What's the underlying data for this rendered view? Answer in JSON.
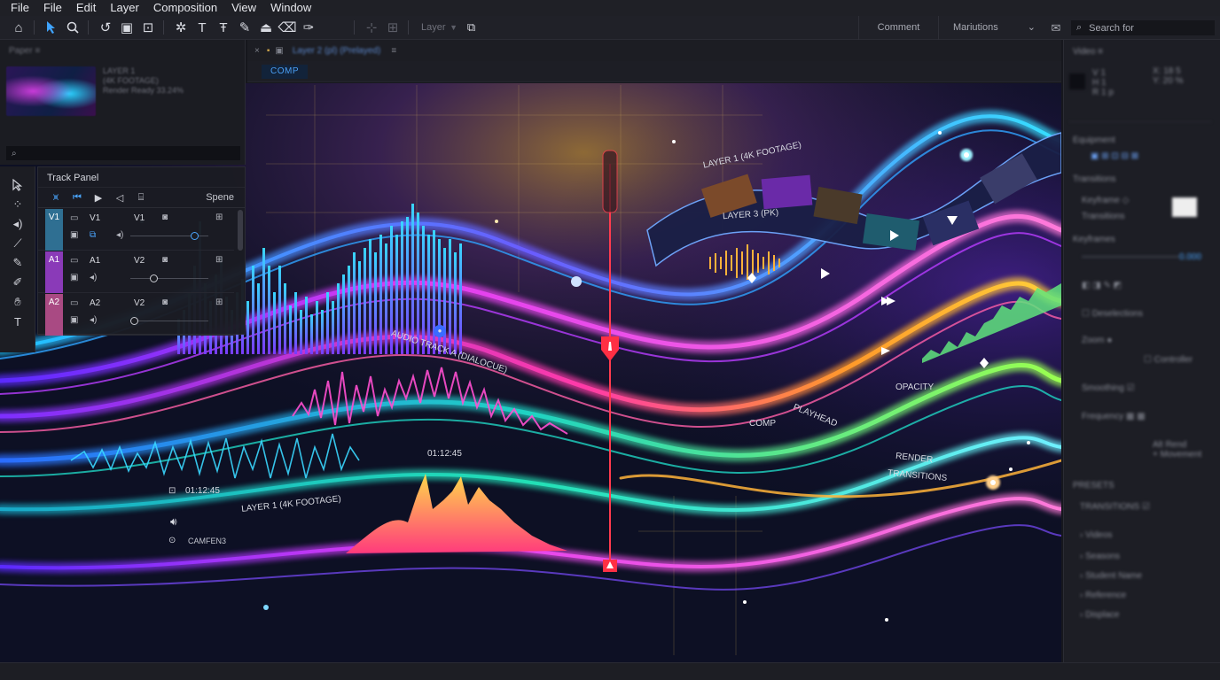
{
  "menu": [
    "File",
    "File",
    "Edit",
    "Layer",
    "Composition",
    "View",
    "Window"
  ],
  "toolbar": {
    "layer_label": "Layer",
    "comment_label": "Comment",
    "markers_label": "Mariutions",
    "search_placeholder": "Search for"
  },
  "comp": {
    "tab_label": "Layer 2 (pl) (Prelayed)",
    "comp_tag": "COMP"
  },
  "track_panel": {
    "title": "Track Panel",
    "mode_label": "Spene",
    "tracks": [
      {
        "id": "V1",
        "name": "V1",
        "out": "V1",
        "color": "#2f6f92"
      },
      {
        "id": "A1",
        "name": "A1",
        "out": "V2",
        "color": "#8a3ab8"
      },
      {
        "id": "A2",
        "name": "A2",
        "out": "V2",
        "color": "#a94a83"
      }
    ]
  },
  "overlay": {
    "timecode_left": "01:12:45",
    "timecode_center": "01:12:45",
    "camera_label": "CAMFEN3",
    "layer1_bottom": "LAYER 1 (4K FOOTAGE)",
    "layer1_top": "LAYER 1 (4K FOOTAGE)",
    "layer3": "LAYER 3 (PK)",
    "audio_track": "AUDIO TRACK A (DIALOCUE)",
    "opacity": "OPACITY",
    "playhead": "PLAYHEAD",
    "comp": "COMP",
    "render": "RENDER",
    "transitions": "TRANSITIONS"
  },
  "colors": {
    "accent": "#3fa3ff",
    "playhead": "#ff3b4e",
    "panel_bg": "#1b1c22"
  }
}
